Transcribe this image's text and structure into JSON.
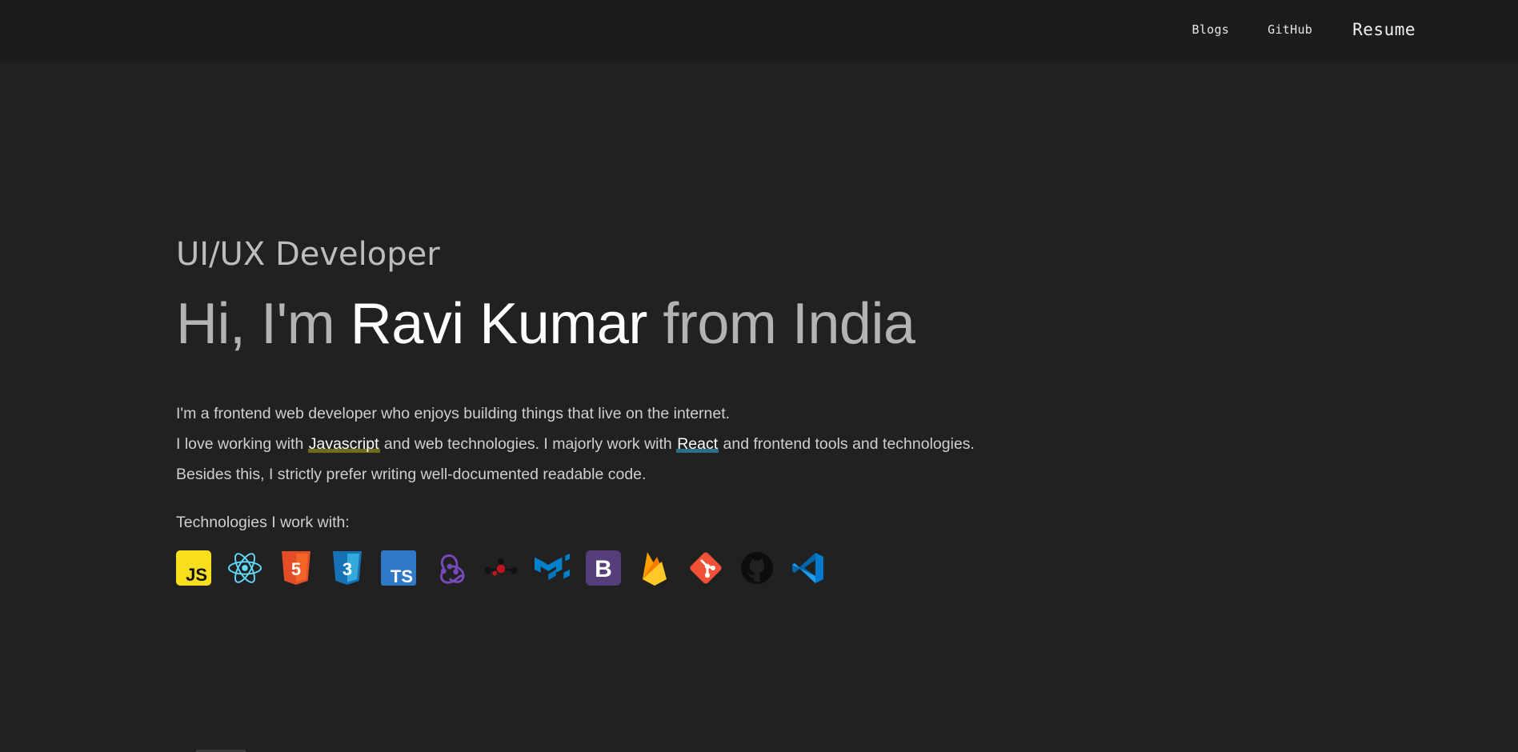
{
  "nav": {
    "blogs": "Blogs",
    "github": "GitHub",
    "resume": "Resume"
  },
  "hero": {
    "role": "UI/UX Developer",
    "greeting": "Hi, I'm ",
    "name": "Ravi Kumar",
    "location": " from India"
  },
  "bio": {
    "line1": "I'm a frontend web developer who enjoys building things that live on the internet.",
    "line2_pre": "I love working with ",
    "line2_highlight1": "Javascript",
    "line2_mid": " and web technologies. I majorly work with ",
    "line2_highlight2": "React",
    "line2_post": " and frontend tools and technologies.",
    "line3": "Besides this, I strictly prefer writing well-documented readable code."
  },
  "technologies": {
    "heading": "Technologies I work with:",
    "items": [
      {
        "icon": "javascript-icon",
        "label": "JS"
      },
      {
        "icon": "react-icon",
        "label": ""
      },
      {
        "icon": "html5-icon",
        "label": "5"
      },
      {
        "icon": "css3-icon",
        "label": "3"
      },
      {
        "icon": "typescript-icon",
        "label": "TS"
      },
      {
        "icon": "redux-icon",
        "label": ""
      },
      {
        "icon": "nodes-graph-icon",
        "label": ""
      },
      {
        "icon": "material-ui-icon",
        "label": ""
      },
      {
        "icon": "bootstrap-icon",
        "label": "B"
      },
      {
        "icon": "firebase-icon",
        "label": ""
      },
      {
        "icon": "git-icon",
        "label": ""
      },
      {
        "icon": "github-icon",
        "label": ""
      },
      {
        "icon": "vscode-icon",
        "label": ""
      }
    ]
  },
  "colors": {
    "background": "#212121",
    "topbar": "#1c1c1c",
    "javascript_highlight": "#6f6b1d",
    "react_highlight": "#2f6f86"
  }
}
